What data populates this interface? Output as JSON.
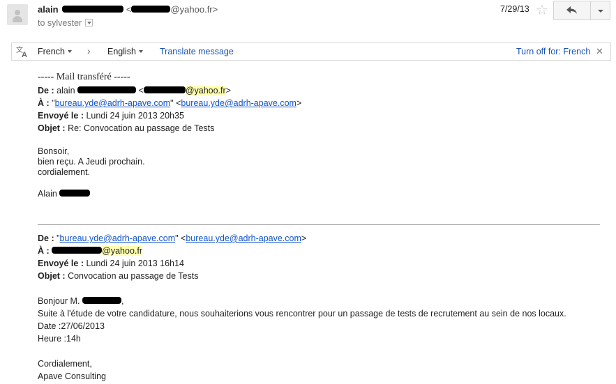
{
  "header": {
    "sender_name": "alain",
    "sender_email_suffix": "@yahoo.fr",
    "email_open": "<",
    "email_close": ">",
    "to_label": "to sylvester",
    "date": "7/29/13",
    "icons": {
      "star": "star-icon",
      "reply": "reply-icon",
      "more": "chevron-down-icon",
      "avatar": "avatar-icon"
    }
  },
  "translate": {
    "source_lang": "French",
    "target_lang": "English",
    "translate_label": "Translate message",
    "turn_off_label": "Turn off for: French",
    "close_glyph": "✕",
    "chevron_glyph": "›"
  },
  "message": {
    "forward_header": "----- Mail transféré -----",
    "fwd": {
      "from_label": "De :",
      "from_name": "alain",
      "from_email_suffix": "@yahoo.fr",
      "to_label": "À :",
      "to_quote_open": "\"",
      "to_name_link": "bureau.yde@adrh-apave.com",
      "to_between": "\" <",
      "to_email_link": "bureau.yde@adrh-apave.com",
      "to_close": ">",
      "sent_label": "Envoyé le :",
      "sent_value": "Lundi 24 juin 2013 20h35",
      "subject_label": "Objet :",
      "subject_value": "Re: Convocation au passage de Tests"
    },
    "reply_body": [
      "Bonsoir,",
      "bien reçu. A Jeudi prochain.",
      "cordialement."
    ],
    "signature_name": "Alain",
    "orig": {
      "from_label": "De :",
      "from_quote_open": "\"",
      "from_name_link": "bureau.yde@adrh-apave.com",
      "from_between": "\" <",
      "from_email_link": "bureau.yde@adrh-apave.com",
      "from_close": ">",
      "to_label": "À :",
      "to_email_suffix": "@yahoo.fr",
      "sent_label": "Envoyé le :",
      "sent_value": "Lundi 24 juin 2013 16h14",
      "subject_label": "Objet :",
      "subject_value": "Convocation au passage de Tests"
    },
    "orig_body": {
      "greeting_prefix": "Bonjour M.",
      "greeting_suffix": ",",
      "line1": "Suite à l'étude de votre candidature, nous souhaiterions vous rencontrer pour un passage de tests de recrutement au sein de nos locaux.",
      "line2": "Date :27/06/2013",
      "line3": "Heure :14h",
      "closing": "Cordialement,",
      "company": "Apave Consulting"
    }
  }
}
